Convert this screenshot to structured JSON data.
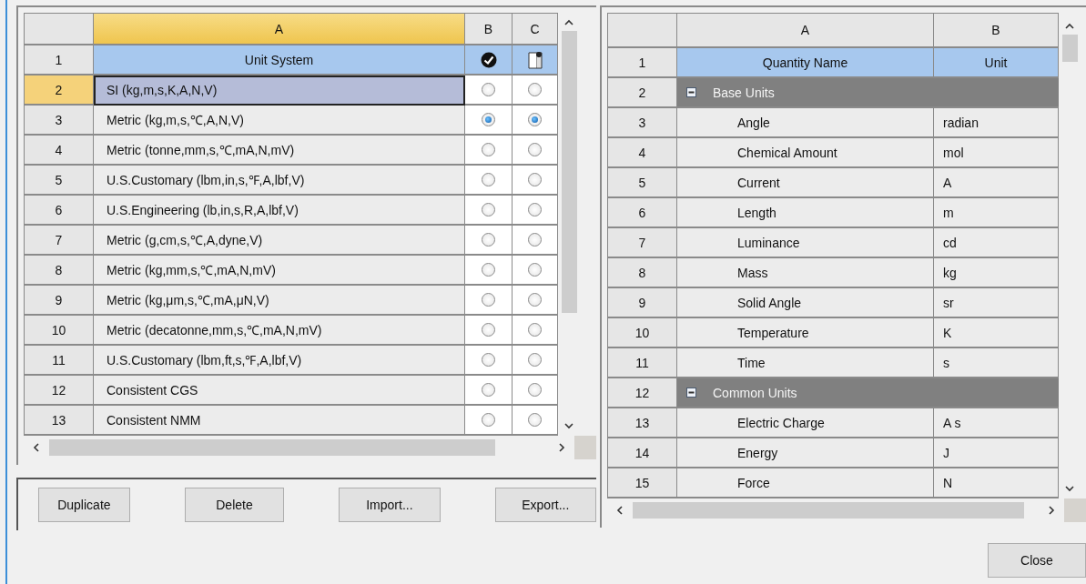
{
  "left_table": {
    "columns": [
      "A",
      "B",
      "C"
    ],
    "header_row": {
      "number": "1",
      "label": "Unit System"
    },
    "rows": [
      {
        "number": "2",
        "name": "SI (kg,m,s,K,A,N,V)",
        "selected": true,
        "b_selected": false,
        "c_selected": false
      },
      {
        "number": "3",
        "name": "Metric (kg,m,s,℃,A,N,V)",
        "selected": false,
        "b_selected": true,
        "c_selected": true
      },
      {
        "number": "4",
        "name": "Metric (tonne,mm,s,℃,mA,N,mV)",
        "selected": false,
        "b_selected": false,
        "c_selected": false
      },
      {
        "number": "5",
        "name": "U.S.Customary (lbm,in,s,℉,A,lbf,V)",
        "selected": false,
        "b_selected": false,
        "c_selected": false
      },
      {
        "number": "6",
        "name": "U.S.Engineering (lb,in,s,R,A,lbf,V)",
        "selected": false,
        "b_selected": false,
        "c_selected": false
      },
      {
        "number": "7",
        "name": "Metric (g,cm,s,℃,A,dyne,V)",
        "selected": false,
        "b_selected": false,
        "c_selected": false
      },
      {
        "number": "8",
        "name": "Metric (kg,mm,s,℃,mA,N,mV)",
        "selected": false,
        "b_selected": false,
        "c_selected": false
      },
      {
        "number": "9",
        "name": "Metric (kg,μm,s,℃,mA,μN,V)",
        "selected": false,
        "b_selected": false,
        "c_selected": false
      },
      {
        "number": "10",
        "name": "Metric (decatonne,mm,s,℃,mA,N,mV)",
        "selected": false,
        "b_selected": false,
        "c_selected": false
      },
      {
        "number": "11",
        "name": "U.S.Customary (lbm,ft,s,℉,A,lbf,V)",
        "selected": false,
        "b_selected": false,
        "c_selected": false
      },
      {
        "number": "12",
        "name": "Consistent CGS",
        "selected": false,
        "b_selected": false,
        "c_selected": false
      },
      {
        "number": "13",
        "name": "Consistent NMM",
        "selected": false,
        "b_selected": false,
        "c_selected": false
      }
    ]
  },
  "buttons": [
    "Duplicate",
    "Delete",
    "Import...",
    "Export..."
  ],
  "right_table": {
    "columns": [
      "A",
      "B"
    ],
    "header_row": {
      "number": "1",
      "name": "Quantity Name",
      "unit": "Unit"
    },
    "rows": [
      {
        "number": "2",
        "kind": "group",
        "name": "Base Units",
        "expanded": true
      },
      {
        "number": "3",
        "kind": "item",
        "name": "Angle",
        "unit": "radian"
      },
      {
        "number": "4",
        "kind": "item",
        "name": "Chemical Amount",
        "unit": "mol"
      },
      {
        "number": "5",
        "kind": "item",
        "name": "Current",
        "unit": "A"
      },
      {
        "number": "6",
        "kind": "item",
        "name": "Length",
        "unit": "m"
      },
      {
        "number": "7",
        "kind": "item",
        "name": "Luminance",
        "unit": "cd"
      },
      {
        "number": "8",
        "kind": "item",
        "name": "Mass",
        "unit": "kg"
      },
      {
        "number": "9",
        "kind": "item",
        "name": "Solid Angle",
        "unit": "sr"
      },
      {
        "number": "10",
        "kind": "item",
        "name": "Temperature",
        "unit": "K"
      },
      {
        "number": "11",
        "kind": "item",
        "name": "Time",
        "unit": "s"
      },
      {
        "number": "12",
        "kind": "group",
        "name": "Common Units",
        "expanded": true
      },
      {
        "number": "13",
        "kind": "item",
        "name": "Electric Charge",
        "unit": "A s"
      },
      {
        "number": "14",
        "kind": "item",
        "name": "Energy",
        "unit": "J"
      },
      {
        "number": "15",
        "kind": "item",
        "name": "Force",
        "unit": "N"
      }
    ]
  },
  "close_button": "Close"
}
